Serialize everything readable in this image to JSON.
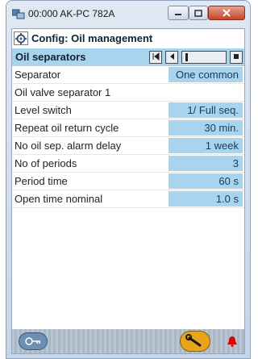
{
  "window": {
    "title": "00:000 AK-PC 782A"
  },
  "header": {
    "title": "Config: Oil management"
  },
  "section": {
    "title": "Oil separators"
  },
  "rows": [
    {
      "label": "Separator",
      "value": "One common"
    },
    {
      "label": "Oil valve separator 1",
      "value": ""
    },
    {
      "label": "Level switch",
      "value": "1/ Full seq."
    },
    {
      "label": "Repeat oil return cycle",
      "value": "30 min."
    },
    {
      "label": "No oil sep. alarm delay",
      "value": "1 week"
    },
    {
      "label": "No of periods",
      "value": "3"
    },
    {
      "label": "Period time",
      "value": "60 s"
    },
    {
      "label": "Open time nominal",
      "value": "1.0 s"
    }
  ],
  "icons": {
    "app": "app-icon",
    "config": "config-icon",
    "first": "first-page-icon",
    "prev": "prev-page-icon",
    "next": "next-page-icon",
    "last": "last-page-icon",
    "login": "login-icon",
    "service": "wrench-icon",
    "alarm": "alarm-bell-icon"
  },
  "colors": {
    "value_bg": "#a8d4ee",
    "alarm": "#e00000",
    "service_button": "#e8a41a"
  }
}
